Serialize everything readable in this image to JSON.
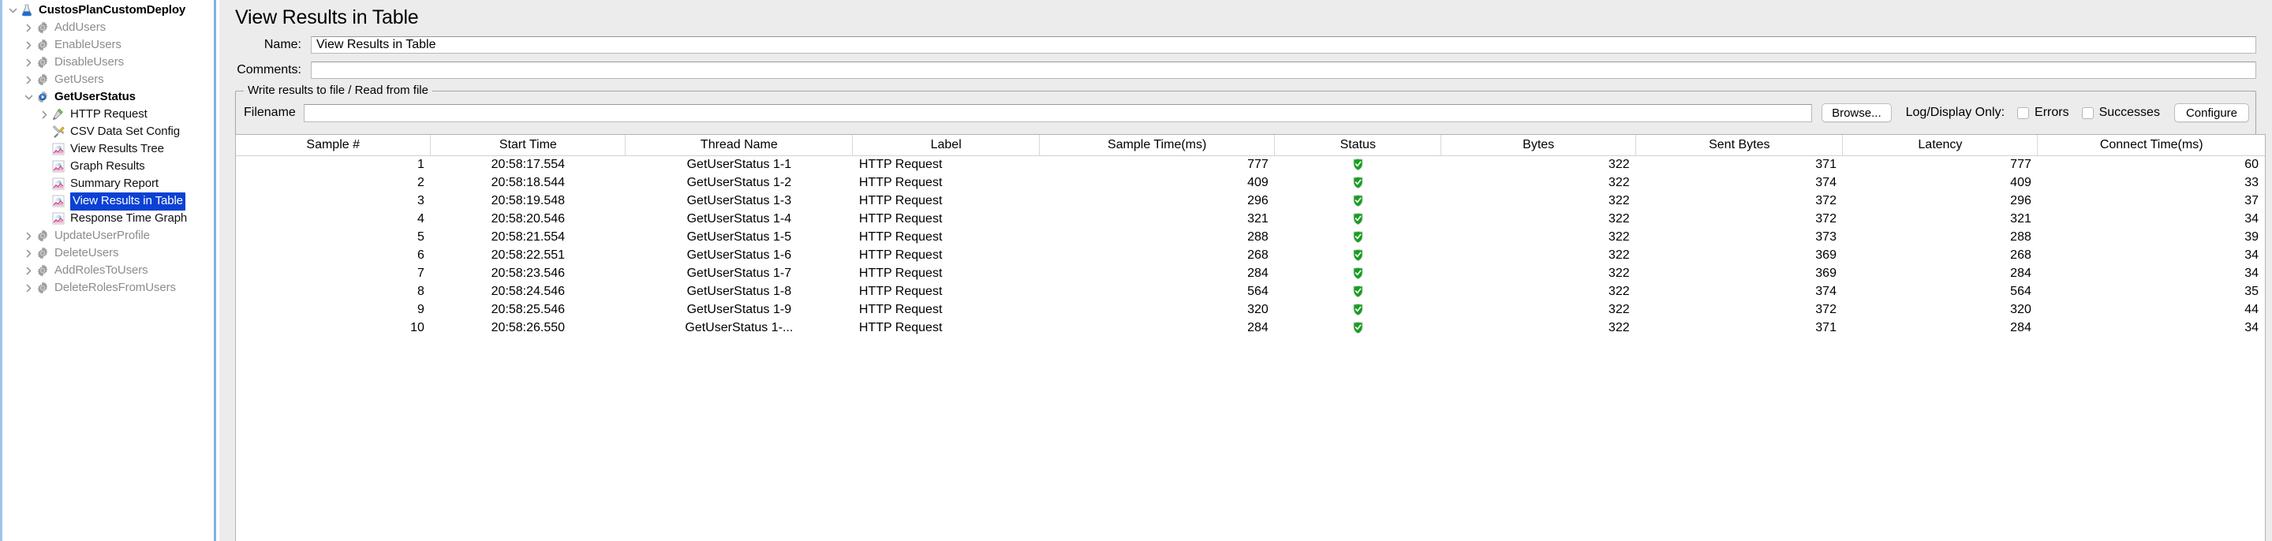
{
  "tree": {
    "items": [
      {
        "label": "CustosPlanCustomDeploy",
        "icon": "test-plan-flask-icon",
        "depth": 0,
        "twisty": "down",
        "style": "bold",
        "selected": false
      },
      {
        "label": "AddUsers",
        "icon": "thread-group-gear-icon",
        "depth": 1,
        "twisty": "right",
        "style": "dim",
        "selected": false
      },
      {
        "label": "EnableUsers",
        "icon": "thread-group-gear-icon",
        "depth": 1,
        "twisty": "right",
        "style": "dim",
        "selected": false
      },
      {
        "label": "DisableUsers",
        "icon": "thread-group-gear-icon",
        "depth": 1,
        "twisty": "right",
        "style": "dim",
        "selected": false
      },
      {
        "label": "GetUsers",
        "icon": "thread-group-gear-icon",
        "depth": 1,
        "twisty": "right",
        "style": "dim",
        "selected": false
      },
      {
        "label": "GetUserStatus",
        "icon": "thread-group-gear-active-icon",
        "depth": 1,
        "twisty": "down",
        "style": "bold",
        "selected": false
      },
      {
        "label": "HTTP Request",
        "icon": "http-request-pipette-icon",
        "depth": 2,
        "twisty": "right",
        "style": "plain",
        "selected": false
      },
      {
        "label": "CSV Data Set Config",
        "icon": "config-element-tools-icon",
        "depth": 2,
        "twisty": "none",
        "style": "plain",
        "selected": false
      },
      {
        "label": "View Results Tree",
        "icon": "listener-chart-icon",
        "depth": 2,
        "twisty": "none",
        "style": "plain",
        "selected": false
      },
      {
        "label": "Graph Results",
        "icon": "listener-chart-icon",
        "depth": 2,
        "twisty": "none",
        "style": "plain",
        "selected": false
      },
      {
        "label": "Summary Report",
        "icon": "listener-chart-icon",
        "depth": 2,
        "twisty": "none",
        "style": "plain",
        "selected": false
      },
      {
        "label": "View Results in Table",
        "icon": "listener-chart-icon",
        "depth": 2,
        "twisty": "none",
        "style": "plain",
        "selected": true
      },
      {
        "label": "Response Time Graph",
        "icon": "listener-chart-icon",
        "depth": 2,
        "twisty": "none",
        "style": "plain",
        "selected": false
      },
      {
        "label": "UpdateUserProfile",
        "icon": "thread-group-gear-icon",
        "depth": 1,
        "twisty": "right",
        "style": "dim",
        "selected": false
      },
      {
        "label": "DeleteUsers",
        "icon": "thread-group-gear-icon",
        "depth": 1,
        "twisty": "right",
        "style": "dim",
        "selected": false
      },
      {
        "label": "AddRolesToUsers",
        "icon": "thread-group-gear-icon",
        "depth": 1,
        "twisty": "right",
        "style": "dim",
        "selected": false
      },
      {
        "label": "DeleteRolesFromUsers",
        "icon": "thread-group-gear-icon",
        "depth": 1,
        "twisty": "right",
        "style": "dim",
        "selected": false
      }
    ]
  },
  "panel": {
    "title": "View Results in Table",
    "name_label": "Name:",
    "name_value": "View Results in Table",
    "comments_label": "Comments:",
    "comments_value": "",
    "comments_placeholder": ""
  },
  "write_group": {
    "title": "Write results to file / Read from file",
    "filename_label": "Filename",
    "filename_value": "",
    "browse_label": "Browse...",
    "logdisplay_label": "Log/Display Only:",
    "errors_label": "Errors",
    "errors_checked": false,
    "successes_label": "Successes",
    "successes_checked": false,
    "configure_label": "Configure"
  },
  "colors": {
    "selection_blue": "#0b41d4",
    "status_green": "#14a01e",
    "panel_bg": "#ececec",
    "divider_blue": "#7fb2e0"
  },
  "table": {
    "columns": [
      "Sample #",
      "Start Time",
      "Thread Name",
      "Label",
      "Sample Time(ms)",
      "Status",
      "Bytes",
      "Sent Bytes",
      "Latency",
      "Connect Time(ms)"
    ],
    "rows": [
      {
        "sample": "1",
        "start_time": "20:58:17.554",
        "thread_name": "GetUserStatus 1-1",
        "label": "HTTP Request",
        "sample_time": "777",
        "status": "success-shield-icon",
        "bytes": "322",
        "sent_bytes": "371",
        "latency": "777",
        "connect_time": "60"
      },
      {
        "sample": "2",
        "start_time": "20:58:18.544",
        "thread_name": "GetUserStatus 1-2",
        "label": "HTTP Request",
        "sample_time": "409",
        "status": "success-shield-icon",
        "bytes": "322",
        "sent_bytes": "374",
        "latency": "409",
        "connect_time": "33"
      },
      {
        "sample": "3",
        "start_time": "20:58:19.548",
        "thread_name": "GetUserStatus 1-3",
        "label": "HTTP Request",
        "sample_time": "296",
        "status": "success-shield-icon",
        "bytes": "322",
        "sent_bytes": "372",
        "latency": "296",
        "connect_time": "37"
      },
      {
        "sample": "4",
        "start_time": "20:58:20.546",
        "thread_name": "GetUserStatus 1-4",
        "label": "HTTP Request",
        "sample_time": "321",
        "status": "success-shield-icon",
        "bytes": "322",
        "sent_bytes": "372",
        "latency": "321",
        "connect_time": "34"
      },
      {
        "sample": "5",
        "start_time": "20:58:21.554",
        "thread_name": "GetUserStatus 1-5",
        "label": "HTTP Request",
        "sample_time": "288",
        "status": "success-shield-icon",
        "bytes": "322",
        "sent_bytes": "373",
        "latency": "288",
        "connect_time": "39"
      },
      {
        "sample": "6",
        "start_time": "20:58:22.551",
        "thread_name": "GetUserStatus 1-6",
        "label": "HTTP Request",
        "sample_time": "268",
        "status": "success-shield-icon",
        "bytes": "322",
        "sent_bytes": "369",
        "latency": "268",
        "connect_time": "34"
      },
      {
        "sample": "7",
        "start_time": "20:58:23.546",
        "thread_name": "GetUserStatus 1-7",
        "label": "HTTP Request",
        "sample_time": "284",
        "status": "success-shield-icon",
        "bytes": "322",
        "sent_bytes": "369",
        "latency": "284",
        "connect_time": "34"
      },
      {
        "sample": "8",
        "start_time": "20:58:24.546",
        "thread_name": "GetUserStatus 1-8",
        "label": "HTTP Request",
        "sample_time": "564",
        "status": "success-shield-icon",
        "bytes": "322",
        "sent_bytes": "374",
        "latency": "564",
        "connect_time": "35"
      },
      {
        "sample": "9",
        "start_time": "20:58:25.546",
        "thread_name": "GetUserStatus 1-9",
        "label": "HTTP Request",
        "sample_time": "320",
        "status": "success-shield-icon",
        "bytes": "322",
        "sent_bytes": "372",
        "latency": "320",
        "connect_time": "44"
      },
      {
        "sample": "10",
        "start_time": "20:58:26.550",
        "thread_name": "GetUserStatus 1-...",
        "label": "HTTP Request",
        "sample_time": "284",
        "status": "success-shield-icon",
        "bytes": "322",
        "sent_bytes": "371",
        "latency": "284",
        "connect_time": "34"
      }
    ]
  }
}
